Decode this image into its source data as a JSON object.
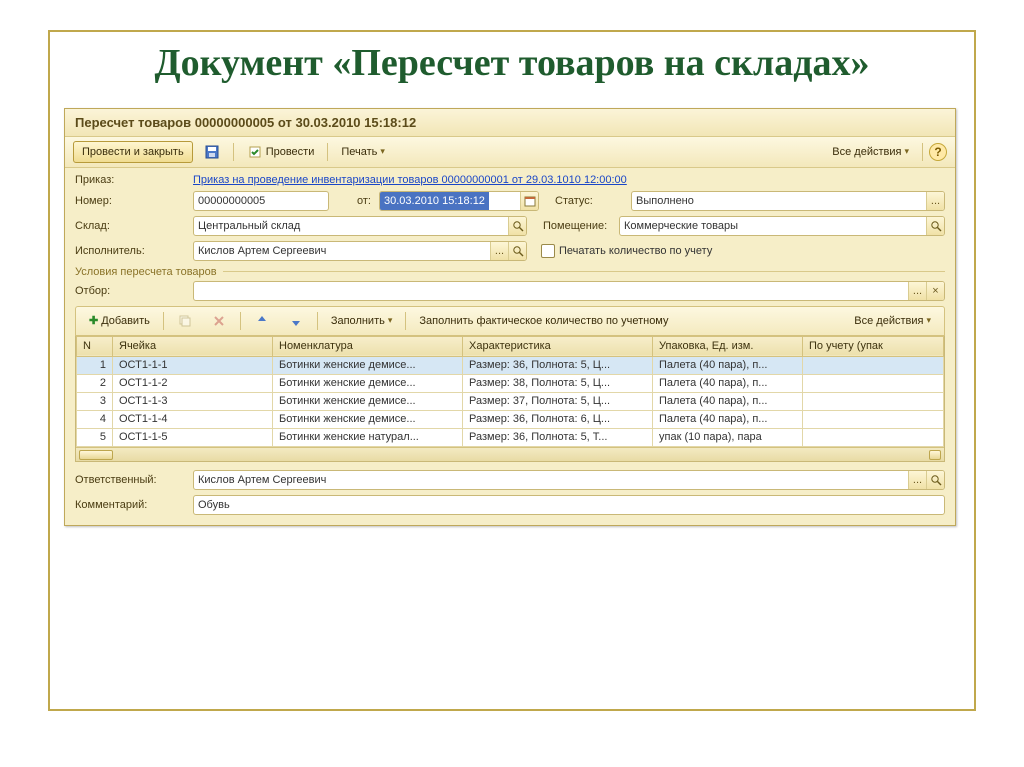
{
  "slide": {
    "title": "Документ «Пересчет товаров на складах»"
  },
  "window": {
    "title": "Пересчет товаров 00000000005 от 30.03.2010 15:18:12"
  },
  "toolbar": {
    "submit_close": "Провести и закрыть",
    "submit": "Провести",
    "print": "Печать",
    "all_actions": "Все действия"
  },
  "fields": {
    "order_label": "Приказ:",
    "order_link": "Приказ на проведение инвентаризации товаров 00000000001 от 29.03.1010 12:00:00",
    "number_label": "Номер:",
    "number_value": "00000000005",
    "from_label": "от:",
    "from_value": "30.03.2010 15:18:12",
    "status_label": "Статус:",
    "status_value": "Выполнено",
    "warehouse_label": "Склад:",
    "warehouse_value": "Центральный склад",
    "room_label": "Помещение:",
    "room_value": "Коммерческие товары",
    "performer_label": "Исполнитель:",
    "performer_value": "Кислов Артем Сергеевич",
    "print_qty_label": "Печатать количество по учету"
  },
  "section": {
    "conditions": "Условия пересчета товаров"
  },
  "filter": {
    "label": "Отбор:"
  },
  "tbl_toolbar": {
    "add": "Добавить",
    "fill": "Заполнить",
    "fill_actual": "Заполнить фактическое количество по учетному",
    "all_actions": "Все действия"
  },
  "columns": {
    "n": "N",
    "cell": "Ячейка",
    "nomen": "Номенклатура",
    "char": "Характеристика",
    "pack": "Упаковка, Ед. изм.",
    "acc": "По учету (упак"
  },
  "rows": [
    {
      "n": "1",
      "cell": "ОСТ1-1-1",
      "nomen": "Ботинки женские демисе...",
      "char": "Размер: 36, Полнота: 5, Ц...",
      "pack": "Палета (40 пара), п..."
    },
    {
      "n": "2",
      "cell": "ОСТ1-1-2",
      "nomen": "Ботинки женские демисе...",
      "char": "Размер: 38, Полнота: 5, Ц...",
      "pack": "Палета (40 пара), п..."
    },
    {
      "n": "3",
      "cell": "ОСТ1-1-3",
      "nomen": "Ботинки женские демисе...",
      "char": "Размер: 37, Полнота: 5, Ц...",
      "pack": "Палета (40 пара), п..."
    },
    {
      "n": "4",
      "cell": "ОСТ1-1-4",
      "nomen": "Ботинки женские демисе...",
      "char": "Размер: 36, Полнота: 6, Ц...",
      "pack": "Палета (40 пара), п..."
    },
    {
      "n": "5",
      "cell": "ОСТ1-1-5",
      "nomen": "Ботинки женские натурал...",
      "char": "Размер: 36, Полнота: 5, Т...",
      "pack": "упак (10 пара), пара"
    }
  ],
  "footer": {
    "resp_label": "Ответственный:",
    "resp_value": "Кислов Артем Сергеевич",
    "comment_label": "Комментарий:",
    "comment_value": "Обувь"
  }
}
